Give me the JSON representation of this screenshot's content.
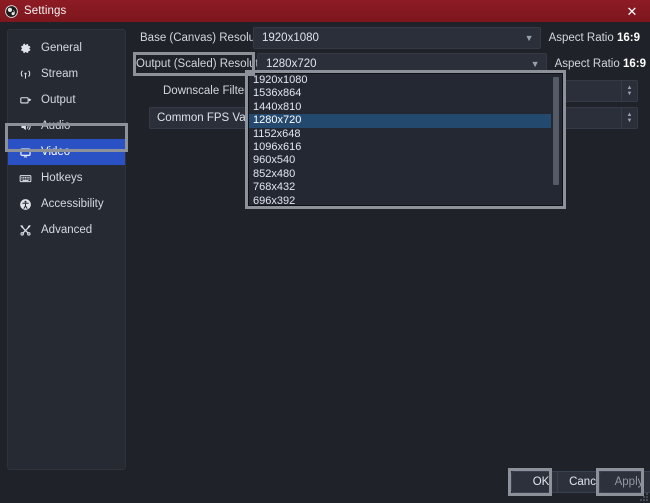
{
  "window": {
    "title": "Settings",
    "app_icon": "obs-logo-icon",
    "close_label": "✕",
    "titlebar_color": "#8b1a22",
    "background_color": "#1f2228"
  },
  "sidebar": {
    "items": [
      {
        "label": "General",
        "icon": "gear-icon",
        "selected": false
      },
      {
        "label": "Stream",
        "icon": "broadcast-icon",
        "selected": false
      },
      {
        "label": "Output",
        "icon": "output-monitor-icon",
        "selected": false
      },
      {
        "label": "Audio",
        "icon": "speaker-icon",
        "selected": false
      },
      {
        "label": "Video",
        "icon": "monitor-icon",
        "selected": true
      },
      {
        "label": "Hotkeys",
        "icon": "keyboard-icon",
        "selected": false
      },
      {
        "label": "Accessibility",
        "icon": "accessibility-icon",
        "selected": false
      },
      {
        "label": "Advanced",
        "icon": "tools-icon",
        "selected": false
      }
    ],
    "selected_color": "#2a52c4"
  },
  "main": {
    "base_resolution": {
      "label": "Base (Canvas) Resolution",
      "value": "1920x1080",
      "aspect_prefix": "Aspect Ratio",
      "aspect_value": "16:9"
    },
    "output_resolution": {
      "label": "Output (Scaled) Resolution",
      "value": "1280x720",
      "aspect_prefix": "Aspect Ratio",
      "aspect_value": "16:9"
    },
    "downscale_filter": {
      "label": "Downscale Filter"
    },
    "fps_type": {
      "value": "Common FPS Values"
    }
  },
  "dropdown": {
    "open": true,
    "selected_value": "1280x720",
    "options": [
      "1920x1080",
      "1536x864",
      "1440x810",
      "1280x720",
      "1152x648",
      "1096x616",
      "960x540",
      "852x480",
      "768x432",
      "696x392"
    ],
    "highlight_color": "#24496f"
  },
  "footer": {
    "ok_label": "OK",
    "cancel_label": "Cancel",
    "apply_label": "Apply"
  },
  "annotations": {
    "color": "#8d9199",
    "targets": [
      "video-sidebar-item",
      "output-scaled-resolution-label",
      "resolution-dropdown-list",
      "ok-button",
      "apply-button"
    ]
  }
}
